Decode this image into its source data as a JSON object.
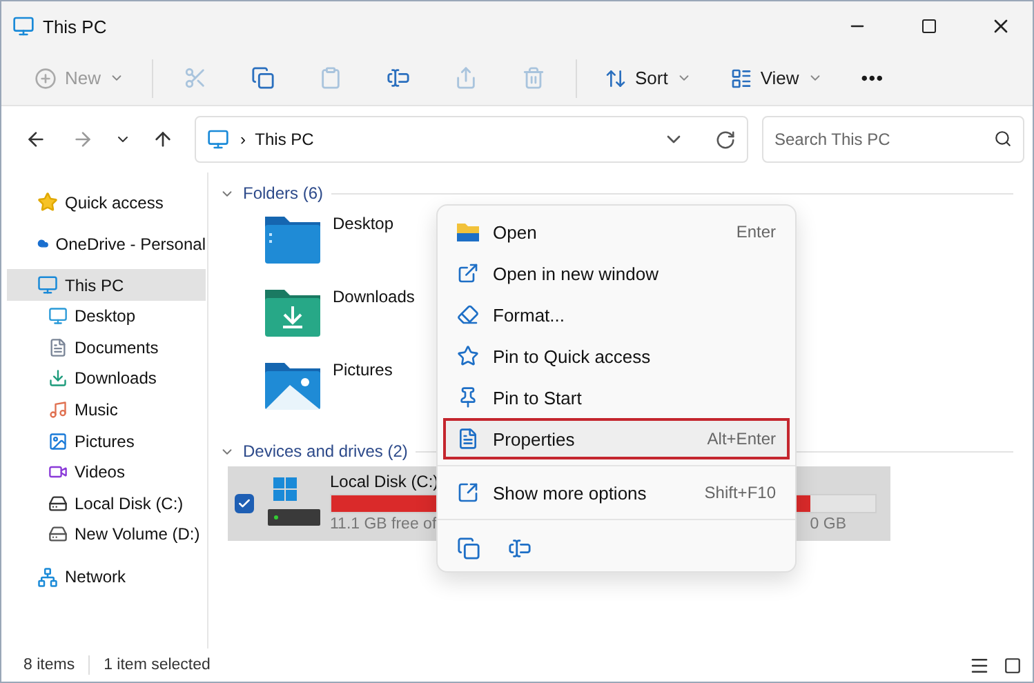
{
  "window": {
    "title": "This PC"
  },
  "toolbar": [
    {
      "kind": "labeled",
      "label": "New",
      "disabled": true,
      "caret": true
    },
    {
      "kind": "icon",
      "disabled": true
    },
    {
      "kind": "icon",
      "disabled": false
    },
    {
      "kind": "icon",
      "disabled": true
    },
    {
      "kind": "icon",
      "disabled": false
    },
    {
      "kind": "icon",
      "disabled": true
    },
    {
      "kind": "icon",
      "disabled": true
    },
    {
      "kind": "labeled",
      "label": "Sort",
      "disabled": false,
      "caret": true
    },
    {
      "kind": "labeled",
      "label": "View",
      "disabled": false,
      "caret": true
    },
    {
      "kind": "more",
      "label": "•••",
      "disabled": false
    }
  ],
  "address": {
    "separator": "›",
    "path": "This PC",
    "search": {
      "placeholder": "Search This PC"
    }
  },
  "sidebar": {
    "items": [
      {
        "label": "Quick access",
        "selected": false
      },
      {
        "label": "OneDrive - Personal",
        "selected": false
      },
      {
        "label": "This PC",
        "selected": true,
        "children": [
          {
            "label": "Desktop",
            "selected": false
          },
          {
            "label": "Documents",
            "selected": false
          },
          {
            "label": "Downloads",
            "selected": false
          },
          {
            "label": "Music",
            "selected": false
          },
          {
            "label": "Pictures",
            "selected": false
          },
          {
            "label": "Videos",
            "selected": false
          },
          {
            "label": "Local Disk (C:)",
            "selected": false
          },
          {
            "label": "New Volume (D:)",
            "selected": false
          }
        ]
      },
      {
        "label": "Network",
        "selected": false
      }
    ]
  },
  "sections": [
    {
      "kind": "folders",
      "title": "Folders (6)",
      "expanded": true,
      "items": [
        {
          "name": "Desktop"
        },
        {
          "name": "Downloads"
        },
        {
          "name": "Pictures"
        }
      ]
    },
    {
      "kind": "drives",
      "title": "Devices and drives (2)",
      "expanded": true,
      "items": [
        {
          "name": "Local Disk (C:)",
          "selected": true,
          "checked": true,
          "level": 0.88,
          "free": "11.1 GB free of",
          "total_tail": "0 GB"
        }
      ]
    }
  ],
  "context_menu": {
    "items": [
      {
        "label": "Open",
        "shortcut": "Enter",
        "selected": false
      },
      {
        "label": "Open in new window",
        "selected": false
      },
      {
        "label": "Format...",
        "selected": false
      },
      {
        "label": "Pin to Quick access",
        "selected": false
      },
      {
        "label": "Pin to Start",
        "selected": false
      },
      {
        "label": "Properties",
        "shortcut": "Alt+Enter",
        "selected": true
      },
      {
        "label": "Show more options",
        "shortcut": "Shift+F10",
        "selected": false
      }
    ]
  },
  "status_bar": {
    "count": "8 items",
    "selection": "1 item selected"
  }
}
